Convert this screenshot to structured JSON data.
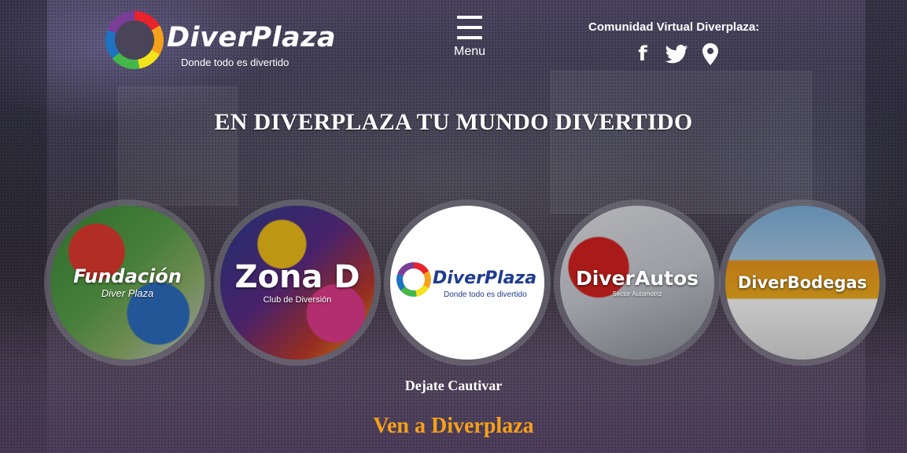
{
  "brand": {
    "name": "DiverPlaza",
    "tagline": "Donde todo es divertido"
  },
  "menu": {
    "label": "Menu"
  },
  "social": {
    "title": "Comunidad Virtual Diverplaza:",
    "facebook_glyph": "f",
    "icons": [
      "facebook-icon",
      "twitter-icon",
      "map-pin-icon"
    ]
  },
  "hero": {
    "headline": "EN DIVERPLAZA TU MUNDO DIVERTIDO"
  },
  "circles": [
    {
      "title": "Fundación",
      "subtitle": "Diver Plaza"
    },
    {
      "title": "Zona D",
      "subtitle": "Club de Diversión"
    },
    {
      "title": "DiverPlaza",
      "subtitle": "Donde todo es divertido"
    },
    {
      "title": "DiverAutos",
      "subtitle": "Sector Automotriz"
    },
    {
      "title": "DiverBodegas",
      "subtitle": ""
    }
  ],
  "tagline_bottom": "Dejate Cautivar",
  "cta": "Ven a Diverplaza",
  "colors": {
    "cta": "#f6a01a",
    "brand_blue": "#1e3b8f"
  }
}
